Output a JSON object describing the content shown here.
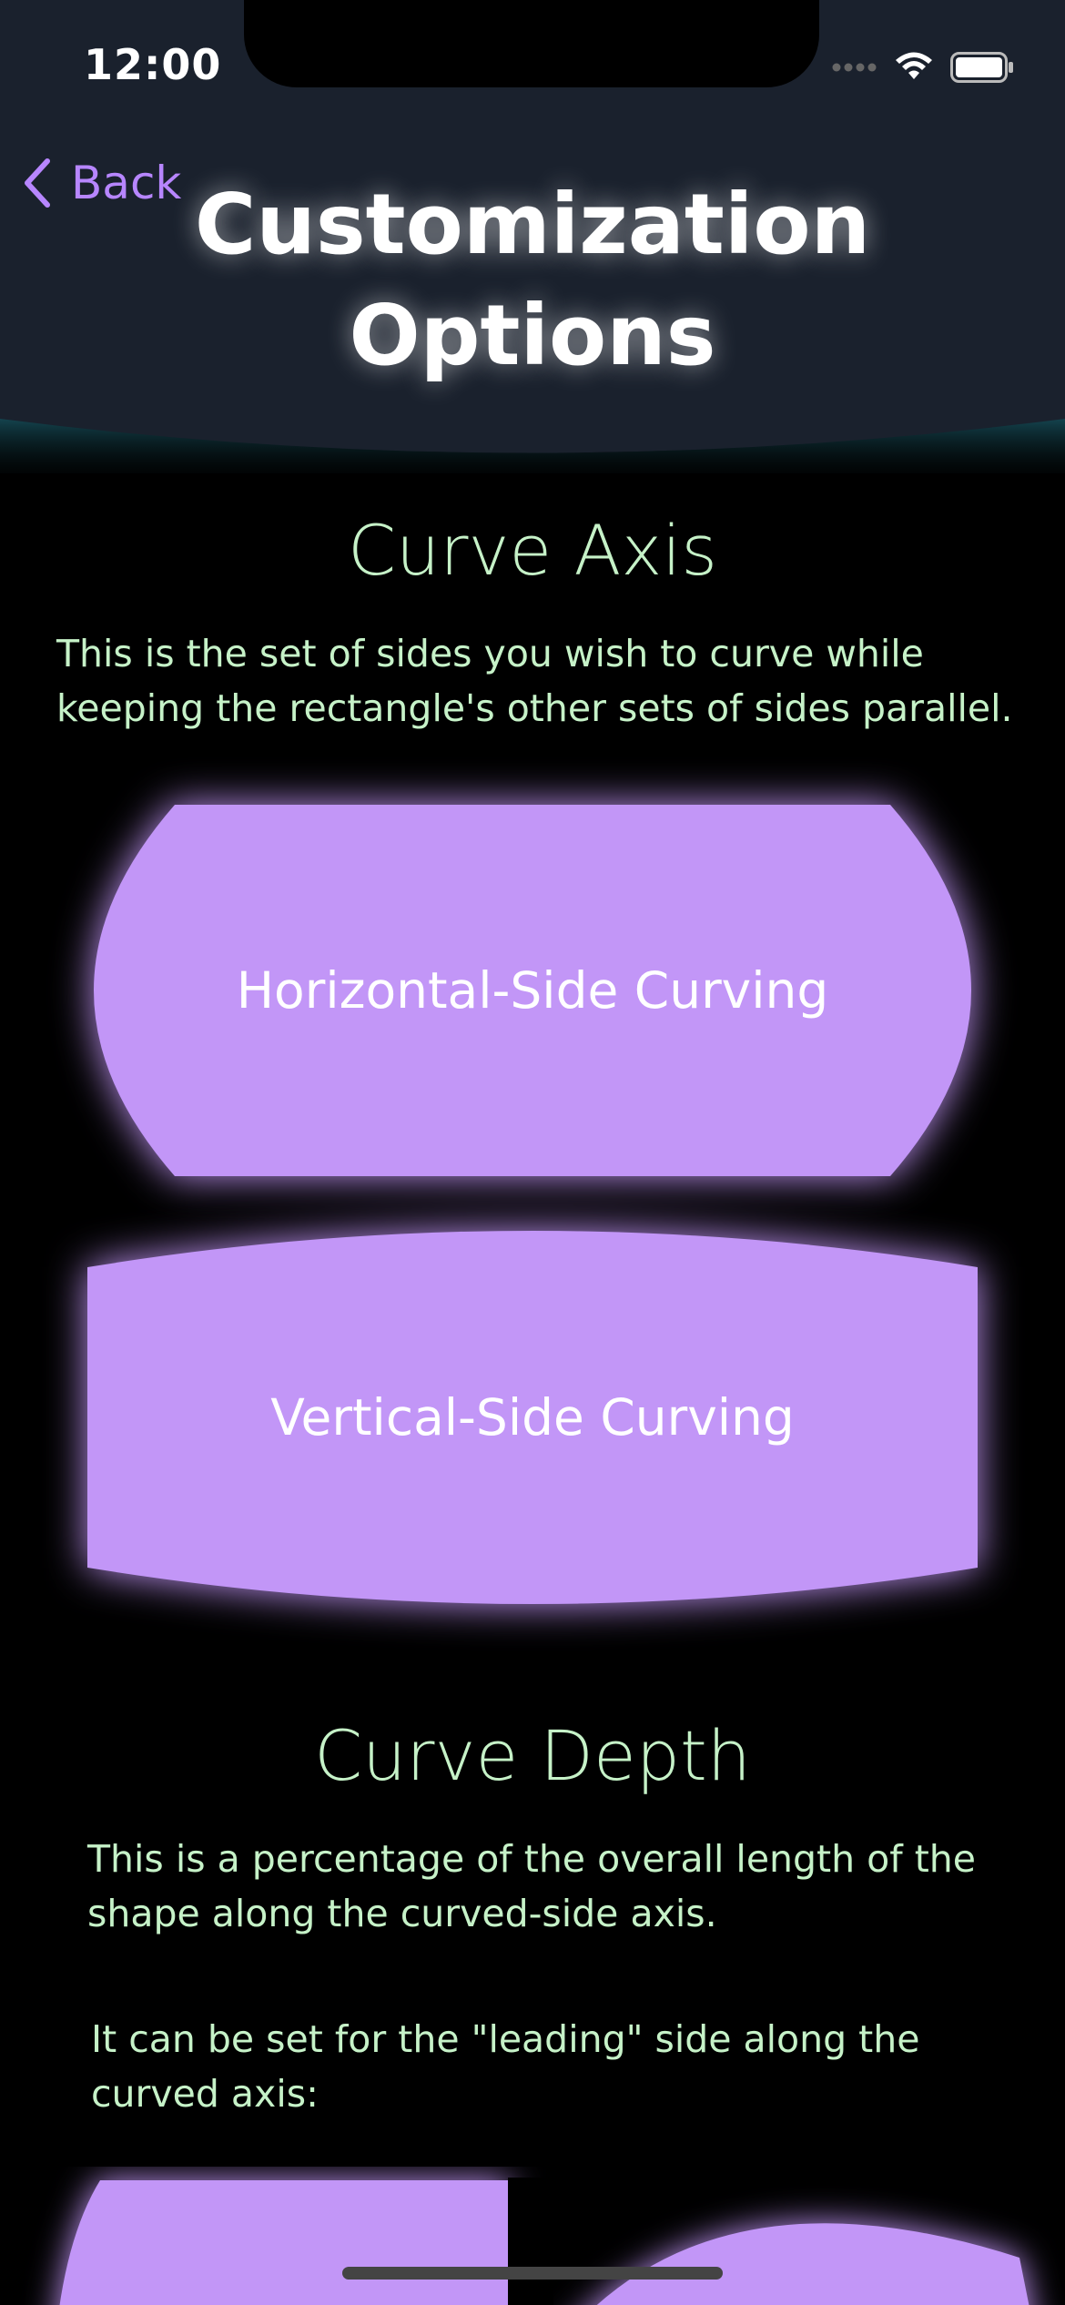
{
  "status_bar": {
    "time": "12:00",
    "signal_icon": "signal-dots-icon",
    "wifi_icon": "wifi-icon",
    "battery_icon": "battery-icon"
  },
  "nav": {
    "back_label": "Back",
    "back_icon": "chevron-left-icon",
    "title": "Customization Options"
  },
  "sections": {
    "curve_axis": {
      "title": "Curve Axis",
      "description": "This is the set of sides you wish to curve while keeping the rectangle's other sets of sides parallel.",
      "options": {
        "horizontal": "Horizontal-Side Curving",
        "vertical": "Vertical-Side Curving"
      }
    },
    "curve_depth": {
      "title": "Curve Depth",
      "description": "This is a percentage of the overall length of the shape along the curved-side axis.",
      "leading_note": "It can be set for the \"leading\" side along the curved axis:"
    }
  },
  "colors": {
    "accent": "#b786ff",
    "button_fill": "#c296f7",
    "section_text": "#c6f2c8",
    "header_bg": "#1a212d",
    "header_glow": "#2a8aa0",
    "background": "#000000"
  }
}
